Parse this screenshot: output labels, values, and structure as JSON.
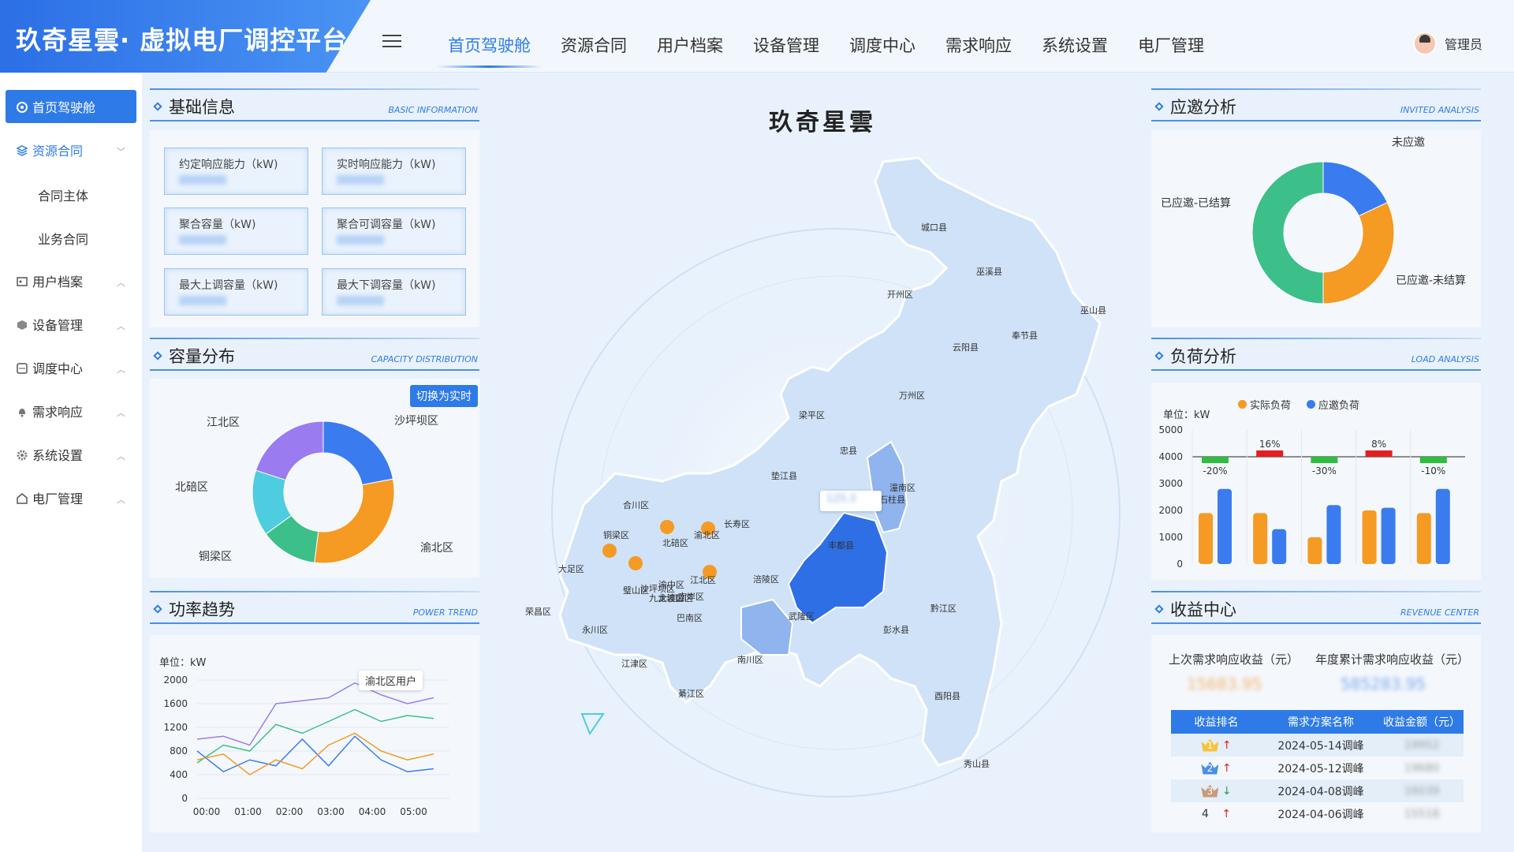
{
  "app": {
    "title": "玖奇星雲· 虚拟电厂调控平台",
    "user": "管理员"
  },
  "nav": [
    {
      "label": "首页驾驶舱"
    },
    {
      "label": "资源合同"
    },
    {
      "label": "用户档案"
    },
    {
      "label": "设备管理"
    },
    {
      "label": "调度中心"
    },
    {
      "label": "需求响应"
    },
    {
      "label": "系统设置"
    },
    {
      "label": "电厂管理"
    }
  ],
  "sidebar": {
    "items": [
      {
        "label": "首页驾驶舱"
      },
      {
        "label": "资源合同"
      },
      {
        "label": "合同主体"
      },
      {
        "label": "业务合同"
      },
      {
        "label": "用户档案"
      },
      {
        "label": "设备管理"
      },
      {
        "label": "调度中心"
      },
      {
        "label": "需求响应"
      },
      {
        "label": "系统设置"
      },
      {
        "label": "电厂管理"
      }
    ]
  },
  "basic_info": {
    "title": "基础信息",
    "title_en": "BASIC INFORMATION",
    "fields": [
      {
        "label": "约定响应能力（kW)"
      },
      {
        "label": "实时响应能力（kW)"
      },
      {
        "label": "聚合容量（kW)"
      },
      {
        "label": "聚合可调容量（kW)"
      },
      {
        "label": "最大上调容量（kW)"
      },
      {
        "label": "最大下调容量（kW)"
      }
    ]
  },
  "capacity": {
    "title": "容量分布",
    "title_en": "CAPACITY DISTRIBUTION",
    "switch_label": "切换为实时",
    "legend": [
      "江北区",
      "沙坪坝区",
      "北碚区",
      "渝北区",
      "铜梁区"
    ]
  },
  "power": {
    "title": "功率趋势",
    "title_en": "POWER TREND",
    "unit": "单位：kW",
    "tooltip": "渝北区用户"
  },
  "map": {
    "title": "玖奇星雲",
    "labels": [
      "城口县",
      "巫溪县",
      "开州区",
      "巫山县",
      "云阳县",
      "奉节县",
      "万州区",
      "梁平区",
      "忠县",
      "垫江县",
      "石柱县",
      "潼南区",
      "合川区",
      "铜梁区",
      "北碚区",
      "渝北区",
      "长寿区",
      "大足区",
      "璧山区",
      "沙坪坝区",
      "九龙坡区",
      "大渡口区",
      "渝中区",
      "江北区",
      "南岸区",
      "涪陵区",
      "丰都县",
      "荣昌区",
      "永川区",
      "巴南区",
      "武隆区",
      "彭水县",
      "黔江区",
      "江津区",
      "綦江区",
      "南川区",
      "酉阳县",
      "秀山县"
    ]
  },
  "invited": {
    "title": "应邀分析",
    "title_en": "INVITED ANALYSIS",
    "legend": [
      "未应邀",
      "已应邀-已结算",
      "已应邀-未结算"
    ]
  },
  "load": {
    "title": "负荷分析",
    "title_en": "LOAD ANALYSIS",
    "unit": "单位：kW",
    "legend": [
      "实际负荷",
      "应邀负荷"
    ]
  },
  "revenue": {
    "title": "收益中心",
    "title_en": "REVENUE CENTER",
    "last_label": "上次需求响应收益（元）",
    "year_label": "年度累计需求响应收益（元）",
    "headers": [
      "收益排名",
      "需求方案名称",
      "收益金额（元）"
    ],
    "rows": [
      {
        "rank": "1",
        "name": "2024-05-14调峰"
      },
      {
        "rank": "2",
        "name": "2024-05-12调峰"
      },
      {
        "rank": "3",
        "name": "2024-04-08调峰"
      },
      {
        "rank": "4",
        "name": "2024-04-06调峰"
      }
    ]
  },
  "colors": {
    "primary": "#2e7be8",
    "orange": "#f59a23",
    "blue": "#3a7cf0",
    "green": "#3dbf8a",
    "teal": "#4ecde0",
    "purple": "#9b7cf0",
    "red": "#e02020"
  },
  "chart_data": [
    {
      "type": "pie",
      "title": "容量分布",
      "categories": [
        "沙坪坝区",
        "渝北区",
        "铜梁区",
        "北碚区",
        "江北区"
      ],
      "values": [
        22,
        30,
        13,
        15,
        20
      ]
    },
    {
      "type": "line",
      "title": "功率趋势",
      "ylabel": "单位：kW",
      "x": [
        "00:00",
        "01:00",
        "02:00",
        "03:00",
        "04:00",
        "05:00"
      ],
      "ylim": [
        0,
        2000
      ],
      "yticks": [
        0,
        400,
        800,
        1200,
        1600,
        2000
      ],
      "series": [
        {
          "values": [
            1000,
            1050,
            900,
            1600,
            1650,
            1700,
            1950,
            1750,
            1600,
            1700
          ]
        },
        {
          "values": [
            600,
            900,
            800,
            1250,
            1100,
            1300,
            1500,
            1300,
            1400,
            1350
          ]
        },
        {
          "values": [
            800,
            450,
            650,
            550,
            1000,
            550,
            1050,
            650,
            450,
            500
          ]
        },
        {
          "values": [
            650,
            750,
            400,
            650,
            500,
            900,
            1100,
            800,
            650,
            750
          ]
        }
      ]
    },
    {
      "type": "pie",
      "title": "应邀分析",
      "categories": [
        "未应邀",
        "已应邀-未结算",
        "已应邀-已结算"
      ],
      "values": [
        18,
        32,
        50
      ]
    },
    {
      "type": "bar",
      "title": "负荷分析",
      "ylabel": "单位：kW",
      "ylim": [
        0,
        5000
      ],
      "yticks": [
        0,
        1000,
        2000,
        3000,
        4000,
        5000
      ],
      "series": [
        {
          "name": "实际负荷",
          "values": [
            1900,
            1900,
            1000,
            2000,
            1900
          ]
        },
        {
          "name": "应邀负荷",
          "values": [
            2800,
            1300,
            2200,
            2100,
            2800
          ]
        }
      ],
      "deviations": [
        "-20%",
        "16%",
        "-30%",
        "8%",
        "-10%"
      ]
    }
  ]
}
